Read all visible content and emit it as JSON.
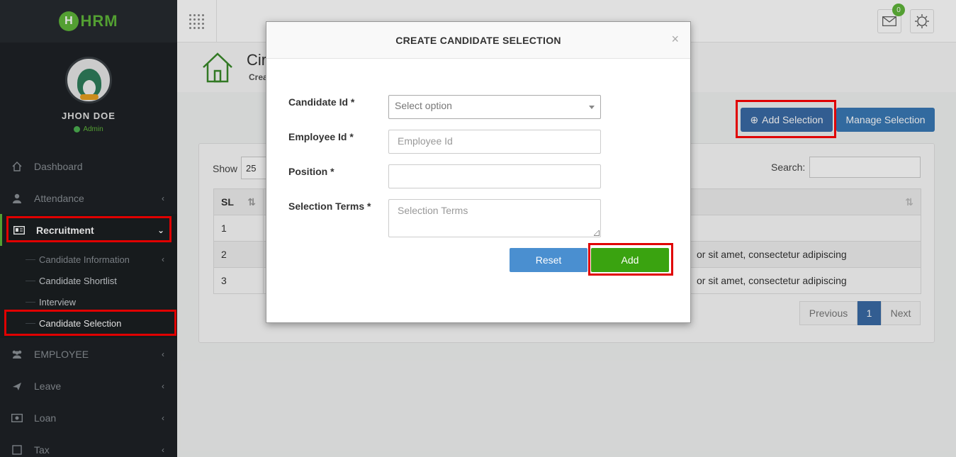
{
  "sidebar": {
    "logo_text": "HRM",
    "logo_letter": "H",
    "user_name": "JHON DOE",
    "user_role": "Admin",
    "menu": {
      "dashboard": "Dashboard",
      "attendance": "Attendance",
      "recruitment": "Recruitment",
      "employee": "EMPLOYEE",
      "leave": "Leave",
      "loan": "Loan",
      "tax": "Tax"
    },
    "submenu": {
      "candidate_information": "Candidate Information",
      "candidate_shortlist": "Candidate Shortlist",
      "interview": "Interview",
      "candidate_selection": "Candidate Selection"
    }
  },
  "topbar": {
    "notification_count": "0"
  },
  "page": {
    "title": "Cir",
    "subtitle": "Crea"
  },
  "actions": {
    "add_selection": "Add Selection",
    "manage_selection": "Manage Selection"
  },
  "table": {
    "show_label": "Show",
    "page_size": "25",
    "search_label": "Search:",
    "header_sl": "SL",
    "rows": [
      {
        "sl": "1",
        "terms": ""
      },
      {
        "sl": "2",
        "terms": "or sit amet, consectetur adipiscing"
      },
      {
        "sl": "3",
        "terms": "or sit amet, consectetur adipiscing"
      }
    ],
    "pagination": {
      "previous": "Previous",
      "current": "1",
      "next": "Next"
    }
  },
  "modal": {
    "title": "CREATE CANDIDATE SELECTION",
    "close": "×",
    "candidate_id_label": "Candidate Id *",
    "candidate_id_placeholder": "Select option",
    "employee_id_label": "Employee Id *",
    "employee_id_placeholder": "Employee Id",
    "position_label": "Position *",
    "position_value": "",
    "selection_terms_label": "Selection Terms *",
    "selection_terms_placeholder": "Selection Terms",
    "reset_label": "Reset",
    "add_label": "Add"
  },
  "colors": {
    "sidebar_bg": "#1e2226",
    "brand_green": "#5fb53a",
    "primary_blue": "#3a6aa5",
    "add_green": "#3aa310",
    "highlight_red": "#e00000"
  }
}
